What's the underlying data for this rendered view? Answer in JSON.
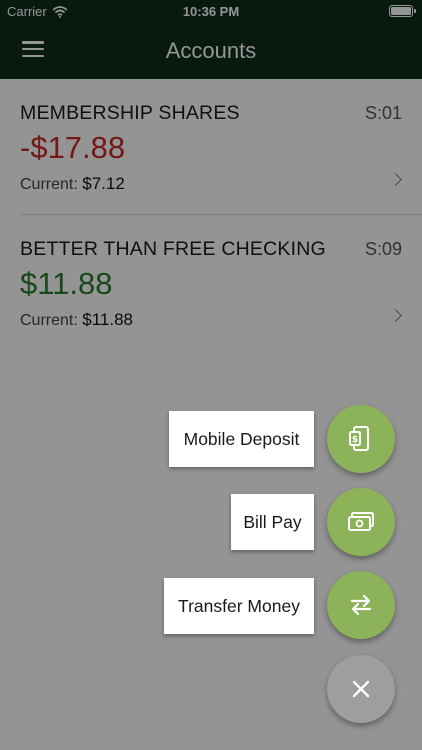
{
  "status_bar": {
    "carrier": "Carrier",
    "time": "10:36 PM",
    "icons": {
      "signal": "wifi-icon",
      "battery": "battery-icon"
    }
  },
  "header": {
    "title": "Accounts",
    "menu_icon": "hamburger-menu-icon",
    "background_color": "#0f2d1c"
  },
  "accounts": [
    {
      "name": "MEMBERSHIP SHARES",
      "suffix": "S:01",
      "balance": "-$17.88",
      "balance_color": "#c62828",
      "current_label": "Current:",
      "current_value": "$7.12"
    },
    {
      "name": "BETTER THAN FREE CHECKING",
      "suffix": "S:09",
      "balance": "$11.88",
      "balance_color": "#2e7d32",
      "current_label": "Current:",
      "current_value": "$11.88"
    }
  ],
  "quick_actions": [
    {
      "label": "Mobile Deposit",
      "icon": "mobile-deposit-icon"
    },
    {
      "label": "Bill Pay",
      "icon": "bill-pay-icon"
    },
    {
      "label": "Transfer Money",
      "icon": "transfer-icon"
    }
  ],
  "close_button": {
    "icon": "close-icon"
  },
  "colors": {
    "action_green": "#8db35a",
    "close_gray": "#9e9e9e",
    "overlay": "rgba(0,0,0,0.42)"
  }
}
